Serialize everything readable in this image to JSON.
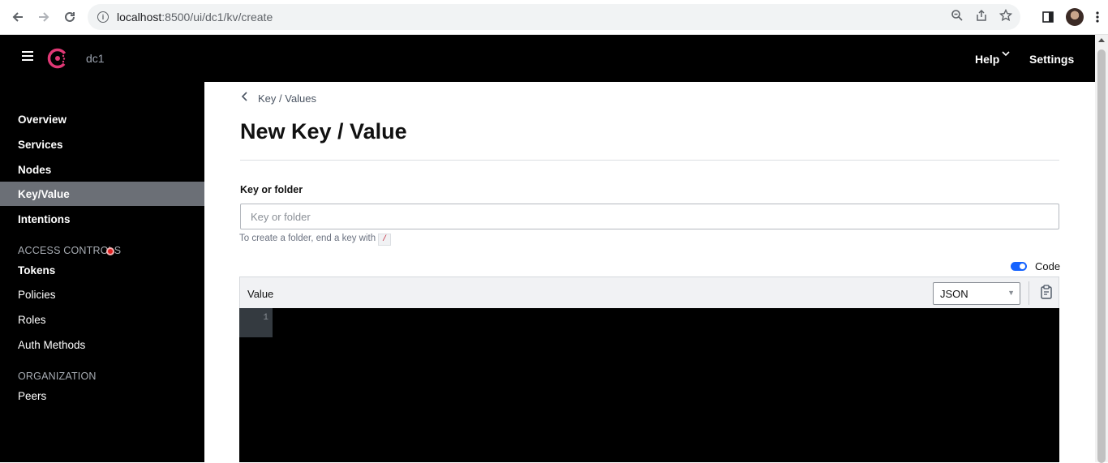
{
  "browser": {
    "url_host": "localhost",
    "url_path": ":8500/ui/dc1/kv/create"
  },
  "topbar": {
    "datacenter": "dc1",
    "help_label": "Help",
    "settings_label": "Settings"
  },
  "sidebar": {
    "items": [
      {
        "label": "Overview"
      },
      {
        "label": "Services"
      },
      {
        "label": "Nodes"
      },
      {
        "label": "Key/Value"
      },
      {
        "label": "Intentions"
      }
    ],
    "access_controls_title": "ACCESS CONTROLS",
    "access_items": [
      {
        "label": "Tokens"
      },
      {
        "label": "Policies"
      },
      {
        "label": "Roles"
      },
      {
        "label": "Auth Methods"
      }
    ],
    "organization_title": "ORGANIZATION",
    "organization_items": [
      {
        "label": "Peers"
      }
    ]
  },
  "main": {
    "breadcrumb": "Key / Values",
    "title": "New Key / Value",
    "key_field_label": "Key or folder",
    "key_field_placeholder": "Key or folder",
    "key_field_value": "",
    "hint_text": "To create a folder, end a key with",
    "hint_code": "/",
    "code_toggle_label": "Code",
    "editor_title": "Value",
    "language_selected": "JSON",
    "line_number": "1"
  },
  "colors": {
    "accent": "#1563ff",
    "brand": "#e03875",
    "sidebar_active": "#6b6f76"
  }
}
